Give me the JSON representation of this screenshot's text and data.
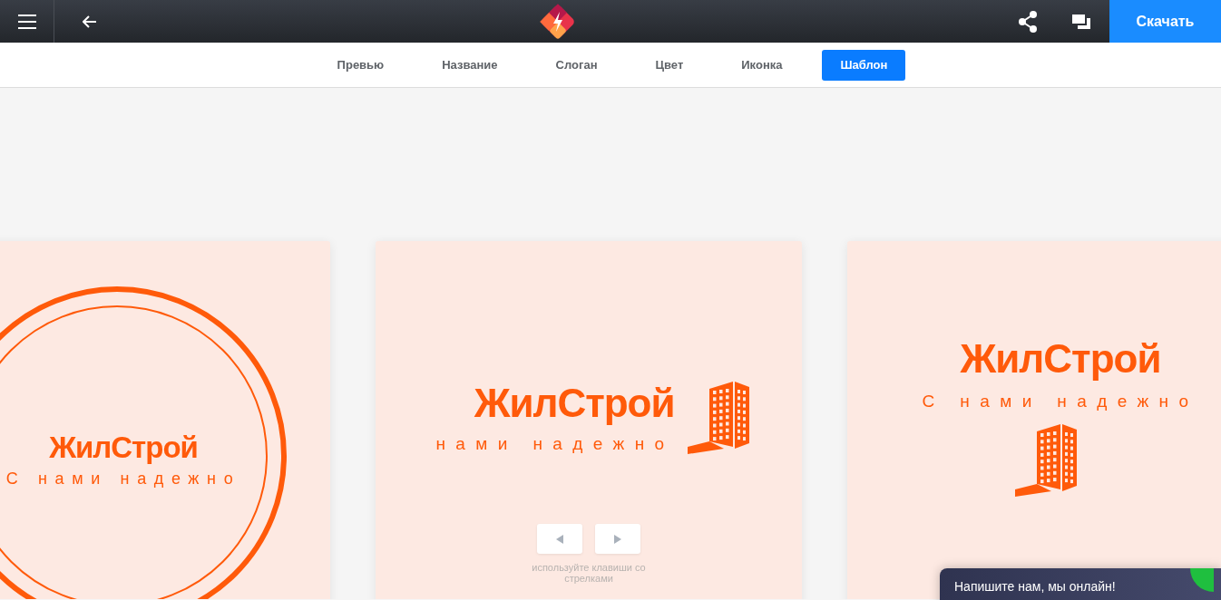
{
  "header": {
    "download_button": "Скачать"
  },
  "tabs": [
    {
      "label": "Превью",
      "selected": false
    },
    {
      "label": "Название",
      "selected": false
    },
    {
      "label": "Слоган",
      "selected": false
    },
    {
      "label": "Цвет",
      "selected": false
    },
    {
      "label": "Иконка",
      "selected": false
    },
    {
      "label": "Шаблон",
      "selected": true
    }
  ],
  "templates": [
    {
      "kind": "badge",
      "name": "ЖилСтрой",
      "slogan": "С нами надежно"
    },
    {
      "kind": "inline",
      "name": "ЖилСтрой",
      "slogan": "нами надежно"
    },
    {
      "kind": "stacked",
      "name": "ЖилСтрой",
      "slogan": "С нами надежно"
    }
  ],
  "carousel": {
    "hint": "используйте клавиши со стрелками"
  },
  "chat": {
    "label": "Напишите нам, мы онлайн!"
  }
}
